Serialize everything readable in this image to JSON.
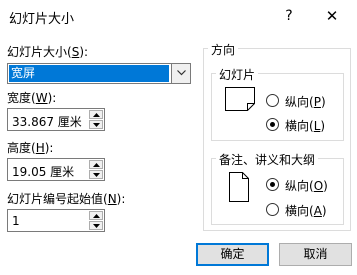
{
  "window": {
    "title": "幻灯片大小",
    "help_label": "?",
    "close_label": "✕"
  },
  "slide_size": {
    "label_pre": "幻灯片大小(",
    "label_key": "S",
    "label_post": "):",
    "value": "宽屏"
  },
  "width": {
    "label_pre": "宽度(",
    "label_key": "W",
    "label_post": "):",
    "value": "33.867 厘米"
  },
  "height": {
    "label_pre": "高度(",
    "label_key": "H",
    "label_post": "):",
    "value": "19.05 厘米"
  },
  "numbering": {
    "label_pre": "幻灯片编号起始值(",
    "label_key": "N",
    "label_post": "):",
    "value": "1"
  },
  "orientation": {
    "legend": "方向",
    "slides": {
      "legend": "幻灯片",
      "portrait_pre": "纵向(",
      "portrait_key": "P",
      "portrait_post": ")",
      "landscape_pre": "横向(",
      "landscape_key": "L",
      "landscape_post": ")",
      "selected": "landscape"
    },
    "notes": {
      "legend": "备注、讲义和大纲",
      "portrait_pre": "纵向(",
      "portrait_key": "O",
      "portrait_post": ")",
      "landscape_pre": "横向(",
      "landscape_key": "A",
      "landscape_post": ")",
      "selected": "portrait"
    }
  },
  "buttons": {
    "ok": "确定",
    "cancel": "取消"
  },
  "colors": {
    "accent": "#0078d7"
  }
}
